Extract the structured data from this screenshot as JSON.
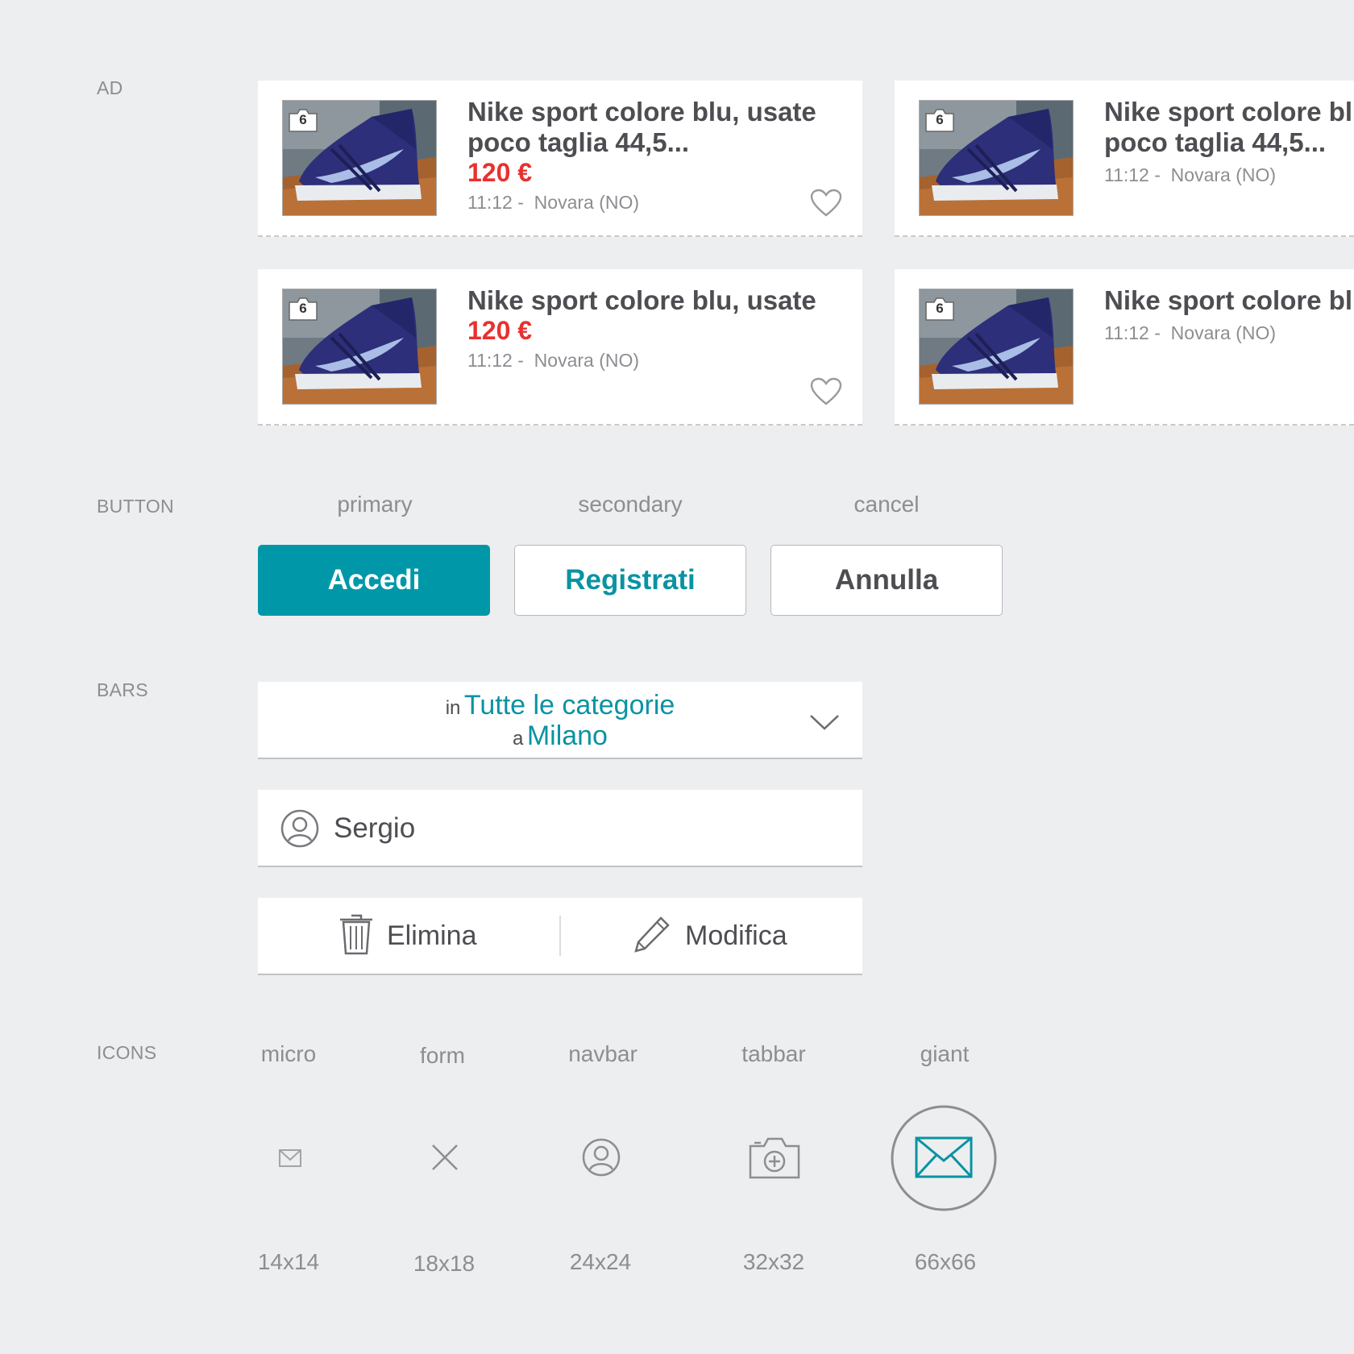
{
  "sections": {
    "ad": "AD",
    "button": "BUTTON",
    "bars": "BARS",
    "icons": "ICONS"
  },
  "ads": [
    {
      "title_line1": "Nike sport colore blu, usate",
      "title_line2": "poco taglia 44,5...",
      "price": "120 €",
      "meta": "11:12 -  Novara (NO)",
      "photo_count": "6"
    },
    {
      "title_line1": "Nike sport colore blu, usate",
      "title_line2": "poco taglia 44,5...",
      "meta": "11:12 -  Novara (NO)",
      "photo_count": "6"
    },
    {
      "title_line1": "Nike sport colore blu, usate",
      "price": "120 €",
      "meta": "11:12 -  Novara (NO)",
      "photo_count": "6"
    },
    {
      "title_line1": "Nike sport colore blu, usate",
      "meta": "11:12 -  Novara (NO)",
      "photo_count": "6"
    }
  ],
  "buttons": {
    "primary_caption": "primary",
    "secondary_caption": "secondary",
    "cancel_caption": "cancel",
    "primary_label": "Accedi",
    "secondary_label": "Registrati",
    "cancel_label": "Annulla"
  },
  "bars": {
    "category_prefix": "in",
    "category_value": "Tutte le categorie",
    "location_prefix": "a",
    "location_value": "Milano",
    "user_name": "Sergio",
    "delete_label": "Elimina",
    "edit_label": "Modifica"
  },
  "icons": [
    {
      "caption": "micro",
      "size": "14x14",
      "icon": "mail-icon"
    },
    {
      "caption": "form",
      "size": "18x18",
      "icon": "close-icon"
    },
    {
      "caption": "navbar",
      "size": "24x24",
      "icon": "user-icon"
    },
    {
      "caption": "tabbar",
      "size": "32x32",
      "icon": "camera-add-icon"
    },
    {
      "caption": "giant",
      "size": "66x66",
      "icon": "mail-icon"
    }
  ],
  "colors": {
    "accent": "#0098a8",
    "price": "#e8312f",
    "background": "#edeef0"
  }
}
